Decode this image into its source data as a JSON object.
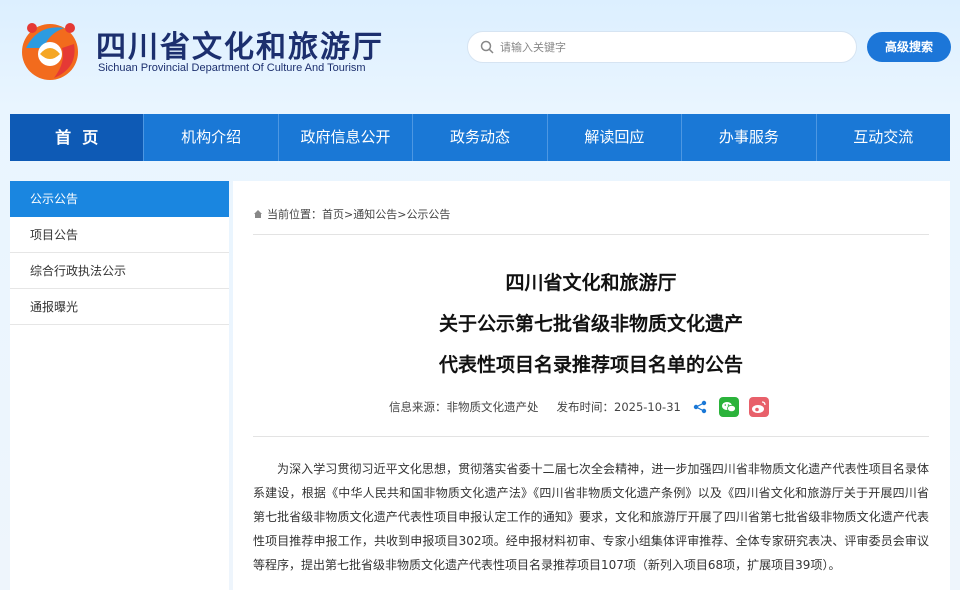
{
  "header": {
    "title": "四川省文化和旅游厅",
    "subtitle": "Sichuan Provincial Department Of Culture And Tourism",
    "search_placeholder": "请输入关键字",
    "advanced_search": "高级搜索"
  },
  "nav": {
    "items": [
      {
        "label": "首  页"
      },
      {
        "label": "机构介绍"
      },
      {
        "label": "政府信息公开"
      },
      {
        "label": "政务动态"
      },
      {
        "label": "解读回应"
      },
      {
        "label": "办事服务"
      },
      {
        "label": "互动交流"
      }
    ]
  },
  "sidebar": {
    "items": [
      {
        "label": "公示公告"
      },
      {
        "label": "项目公告"
      },
      {
        "label": "综合行政执法公示"
      },
      {
        "label": "通报曝光"
      }
    ]
  },
  "breadcrumb": {
    "prefix": "当前位置：",
    "home": "首页",
    "level1": "通知公告",
    "level2": "公示公告",
    "sep": ">"
  },
  "article": {
    "title_line1": "四川省文化和旅游厅",
    "title_line2": "关于公示第七批省级非物质文化遗产",
    "title_line3": "代表性项目名录推荐项目名单的公告",
    "source_label": "信息来源：",
    "source": "非物质文化遗产处",
    "date_label": "发布时间：",
    "date": "2025-10-31",
    "body": "为深入学习贯彻习近平文化思想，贯彻落实省委十二届七次全会精神，进一步加强四川省非物质文化遗产代表性项目名录体系建设，根据《中华人民共和国非物质文化遗产法》《四川省非物质文化遗产条例》以及《四川省文化和旅游厅关于开展四川省第七批省级非物质文化遗产代表性项目申报认定工作的通知》要求，文化和旅游厅开展了四川省第七批省级非物质文化遗产代表性项目推荐申报工作，共收到申报项目302项。经申报材料初审、专家小组集体评审推荐、全体专家研究表决、评审委员会审议等程序，提出第七批省级非物质文化遗产代表性项目名录推荐项目107项（新列入项目68项，扩展项目39项）。"
  },
  "colors": {
    "nav_bg": "#1a78d6",
    "nav_active": "#0e5ab5",
    "sidebar_active": "#1a86e0",
    "title_color": "#1c2f6e"
  }
}
